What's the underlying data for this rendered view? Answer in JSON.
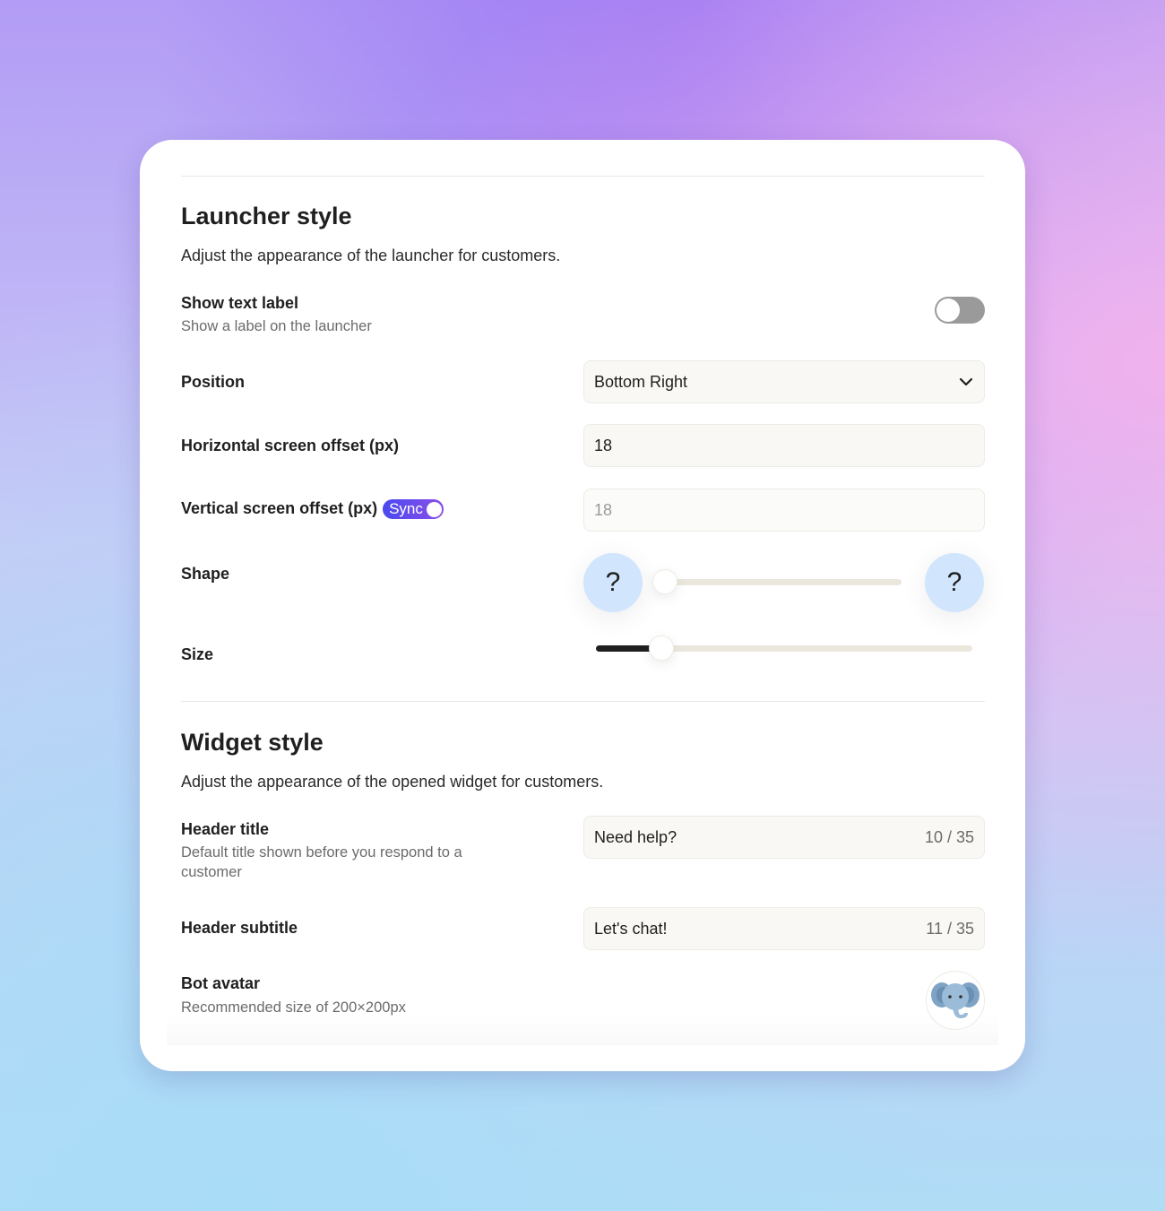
{
  "launcher": {
    "title": "Launcher style",
    "description": "Adjust the appearance of the launcher for customers.",
    "show_text_label": {
      "label": "Show text label",
      "sublabel": "Show a label on the launcher",
      "enabled": false
    },
    "position": {
      "label": "Position",
      "value": "Bottom Right"
    },
    "horizontal_offset": {
      "label": "Horizontal screen offset (px)",
      "value": "18"
    },
    "vertical_offset": {
      "label": "Vertical screen offset (px)",
      "value": "18",
      "sync_label": "Sync",
      "sync_enabled": true
    },
    "shape": {
      "label": "Shape",
      "icon_glyph": "?",
      "value_percent": 0
    },
    "size": {
      "label": "Size",
      "value_percent": 14
    }
  },
  "widget": {
    "title": "Widget style",
    "description": "Adjust the appearance of the opened widget for customers.",
    "header_title": {
      "label": "Header title",
      "sublabel": "Default title shown before you respond to a customer",
      "value": "Need help?",
      "counter": "10 / 35"
    },
    "header_subtitle": {
      "label": "Header subtitle",
      "value": "Let's chat!",
      "counter": "11 / 35"
    },
    "bot_avatar": {
      "label": "Bot avatar",
      "sublabel": "Recommended size of 200×200px",
      "icon": "elephant-avatar"
    }
  },
  "colors": {
    "sync_accent": "#5b4af0",
    "shape_bubble": "#d1e5fd"
  }
}
